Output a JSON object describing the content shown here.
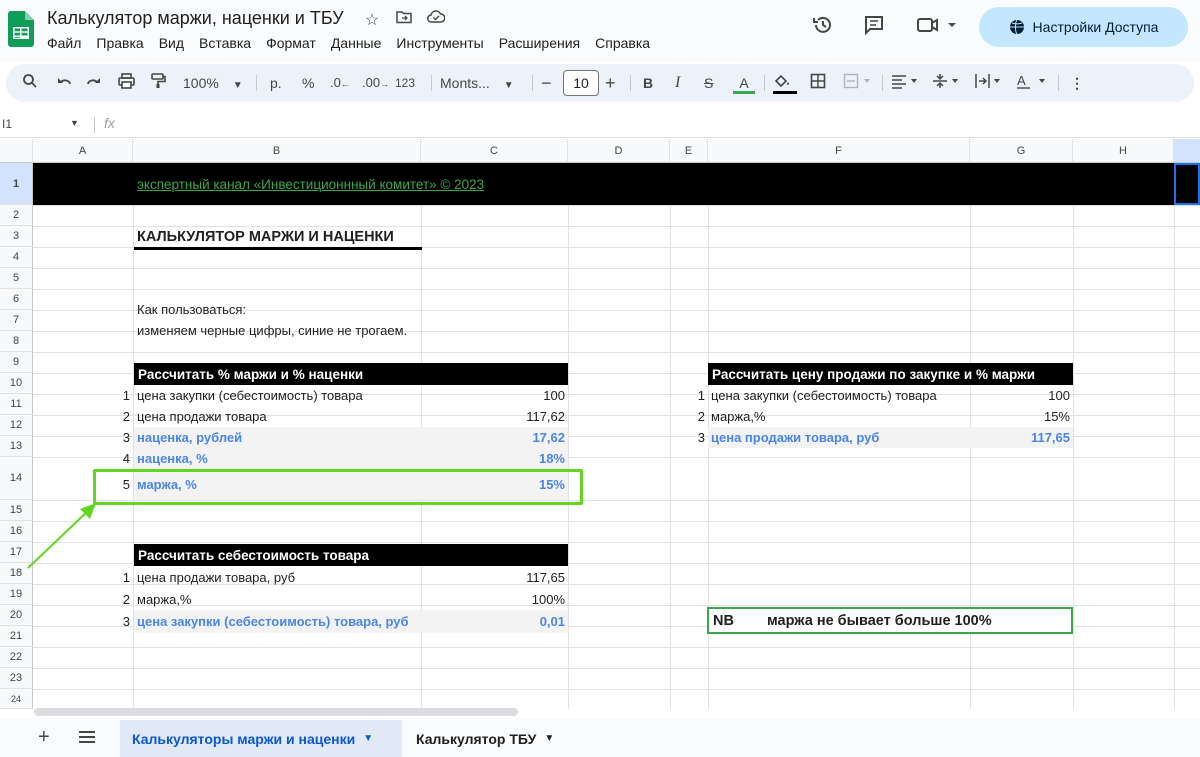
{
  "doc": {
    "title": "Калькулятор маржи, наценки и ТБУ"
  },
  "menu": [
    "Файл",
    "Правка",
    "Вид",
    "Вставка",
    "Формат",
    "Данные",
    "Инструменты",
    "Расширения",
    "Справка"
  ],
  "share": {
    "label": "Настройки Доступа"
  },
  "toolbar": {
    "zoom": "100%",
    "currency": "р.",
    "percent": "%",
    "dec_minus": ".0",
    "dec_plus": ".00",
    "format_123": "123",
    "font": "Monts...",
    "font_size": "10"
  },
  "formula_bar": {
    "cell_ref": "I1",
    "fx": "fx"
  },
  "columns": [
    "A",
    "B",
    "C",
    "D",
    "E",
    "F",
    "G",
    "H"
  ],
  "rows": [
    "1",
    "2",
    "3",
    "4",
    "5",
    "6",
    "7",
    "8",
    "9",
    "10",
    "11",
    "12",
    "13",
    "14",
    "15",
    "16",
    "17",
    "18",
    "19",
    "20",
    "21",
    "22",
    "23",
    "24"
  ],
  "sheet": {
    "banner": "экспертный канал «Инвестиционнный комитет» © 2023",
    "heading": "КАЛЬКУЛЯТОР МАРЖИ И НАЦЕНКИ",
    "howto_1": "Как пользоваться:",
    "howto_2": "изменяем черные цифры, синие не трогаем.",
    "t1": {
      "header": "Рассчитать % маржи и % наценки",
      "rows": [
        {
          "n": "1",
          "label": "цена закупки (себестоимость) товара",
          "value": "100"
        },
        {
          "n": "2",
          "label": "цена продажи товара",
          "value": "117,62"
        },
        {
          "n": "3",
          "label": "наценка, рублей",
          "value": "17,62"
        },
        {
          "n": "4",
          "label": "наценка, %",
          "value": "18%"
        },
        {
          "n": "5",
          "label": "маржа, %",
          "value": "15%"
        }
      ]
    },
    "t2": {
      "header": "Рассчитать себестоимость товара",
      "rows": [
        {
          "n": "1",
          "label": "цена продажи товара, руб",
          "value": "117,65"
        },
        {
          "n": "2",
          "label": "маржа,%",
          "value": "100%"
        },
        {
          "n": "3",
          "label": "цена закупки (себестоимость) товара, руб",
          "value": "0,01"
        }
      ]
    },
    "t3": {
      "header": "Рассчитать цену продажи по закупке и % маржи",
      "rows": [
        {
          "n": "1",
          "label": "цена закупки (себестоимость) товара",
          "value": "100"
        },
        {
          "n": "2",
          "label": "маржа,%",
          "value": "15%"
        },
        {
          "n": "3",
          "label": "цена продажи товара, руб",
          "value": "117,65"
        }
      ]
    },
    "nb": {
      "tag": "NB",
      "text": "маржа не бывает больше 100%"
    }
  },
  "tabs": [
    {
      "label": "Калькуляторы маржи и наценки"
    },
    {
      "label": "Калькулятор ТБУ"
    }
  ],
  "colors": {
    "accent": "#63d61f",
    "link": "#3aa84a",
    "blue_text": "#4a86e8"
  }
}
